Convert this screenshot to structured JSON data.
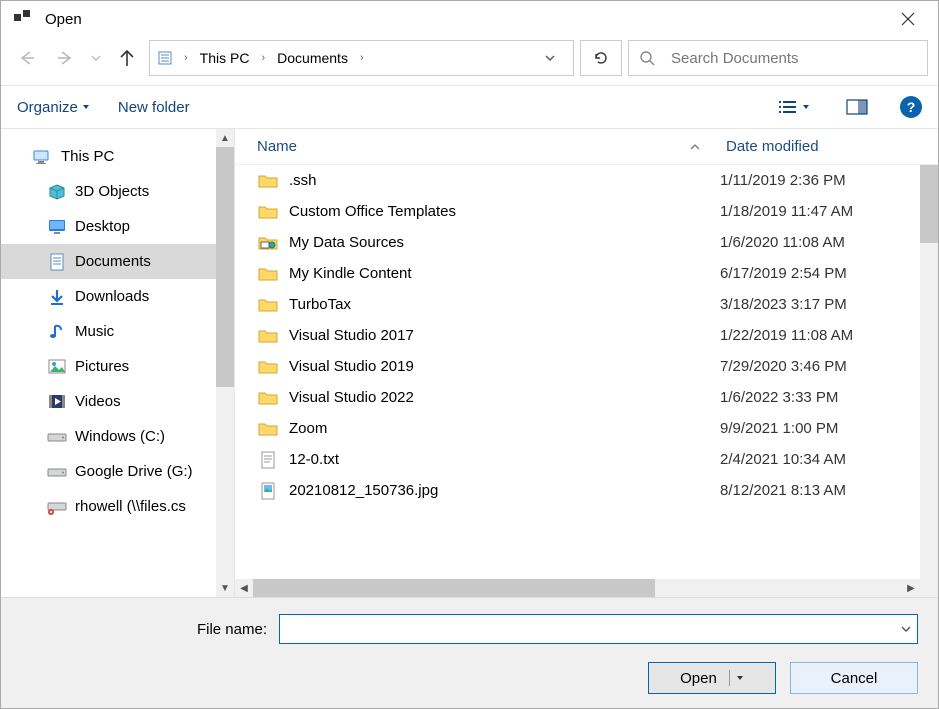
{
  "window": {
    "title": "Open"
  },
  "breadcrumb": {
    "items": [
      "This PC",
      "Documents"
    ]
  },
  "search": {
    "placeholder": "Search Documents"
  },
  "toolbar": {
    "organize": "Organize",
    "new_folder": "New folder"
  },
  "sidebar": {
    "root": "This PC",
    "items": [
      {
        "label": "3D Objects",
        "icon": "cube"
      },
      {
        "label": "Desktop",
        "icon": "desktop"
      },
      {
        "label": "Documents",
        "icon": "doc",
        "selected": true
      },
      {
        "label": "Downloads",
        "icon": "download"
      },
      {
        "label": "Music",
        "icon": "music"
      },
      {
        "label": "Pictures",
        "icon": "pictures"
      },
      {
        "label": "Videos",
        "icon": "videos"
      },
      {
        "label": "Windows (C:)",
        "icon": "drive"
      },
      {
        "label": "Google Drive (G:)",
        "icon": "drive"
      },
      {
        "label": "rhowell (\\\\files.cs",
        "icon": "netdrive"
      }
    ]
  },
  "columns": {
    "name": "Name",
    "date": "Date modified"
  },
  "files": [
    {
      "name": ".ssh",
      "date": "1/11/2019 2:36 PM",
      "kind": "folder"
    },
    {
      "name": "Custom Office Templates",
      "date": "1/18/2019 11:47 AM",
      "kind": "folder"
    },
    {
      "name": "My Data Sources",
      "date": "1/6/2020 11:08 AM",
      "kind": "specialfolder"
    },
    {
      "name": "My Kindle Content",
      "date": "6/17/2019 2:54 PM",
      "kind": "folder"
    },
    {
      "name": "TurboTax",
      "date": "3/18/2023 3:17 PM",
      "kind": "folder"
    },
    {
      "name": "Visual Studio 2017",
      "date": "1/22/2019 11:08 AM",
      "kind": "folder"
    },
    {
      "name": "Visual Studio 2019",
      "date": "7/29/2020 3:46 PM",
      "kind": "folder"
    },
    {
      "name": "Visual Studio 2022",
      "date": "1/6/2022 3:33 PM",
      "kind": "folder"
    },
    {
      "name": "Zoom",
      "date": "9/9/2021 1:00 PM",
      "kind": "folder"
    },
    {
      "name": "12-0.txt",
      "date": "2/4/2021 10:34 AM",
      "kind": "textfile"
    },
    {
      "name": "20210812_150736.jpg",
      "date": "8/12/2021 8:13 AM",
      "kind": "imagefile"
    }
  ],
  "footer": {
    "filename_label": "File name:",
    "filename_value": "",
    "open": "Open",
    "cancel": "Cancel"
  }
}
